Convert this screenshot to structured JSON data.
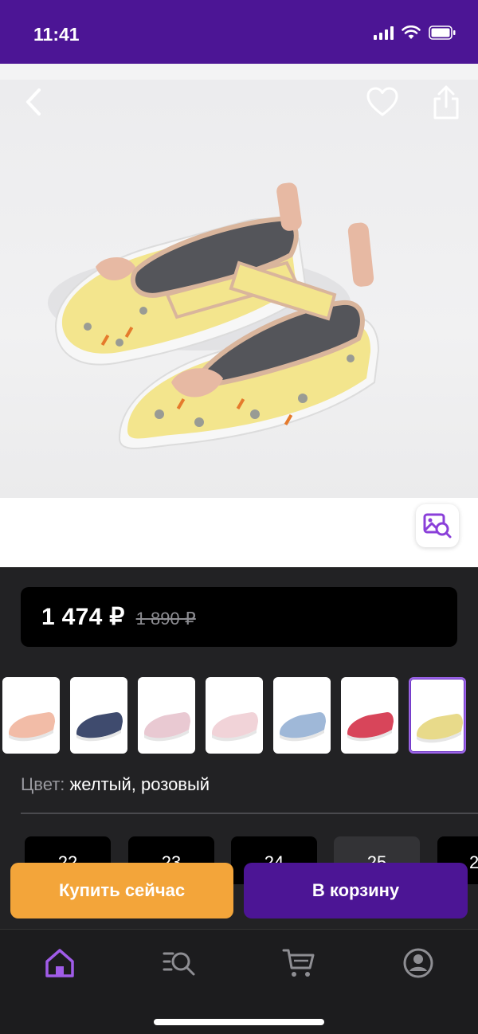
{
  "status_bar": {
    "time": "11:41"
  },
  "product": {
    "price_current": "1 474 ₽",
    "price_old": "1 890 ₽",
    "color_label": "Цвет:",
    "color_value": "желтый, розовый"
  },
  "thumbnails": [
    {
      "name": "thumb-pink",
      "color": "#f2bca7",
      "selected": false
    },
    {
      "name": "thumb-navy",
      "color": "#3f4b6e",
      "selected": false
    },
    {
      "name": "thumb-lightpink",
      "color": "#e9c9d2",
      "selected": false
    },
    {
      "name": "thumb-blush",
      "color": "#f1d3d8",
      "selected": false
    },
    {
      "name": "thumb-blue",
      "color": "#9fb8d8",
      "selected": false
    },
    {
      "name": "thumb-red",
      "color": "#d8455a",
      "selected": false
    },
    {
      "name": "thumb-yellow",
      "color": "#e8da8a",
      "selected": true
    }
  ],
  "sizes": [
    "22",
    "23",
    "24",
    "25",
    "2"
  ],
  "actions": {
    "buy_now": "Купить сейчас",
    "add_to_cart": "В корзину"
  },
  "tabs": [
    {
      "name": "home",
      "icon": "home-icon",
      "active": true
    },
    {
      "name": "search",
      "icon": "search-list-icon",
      "active": false
    },
    {
      "name": "cart",
      "icon": "cart-icon",
      "active": false
    },
    {
      "name": "profile",
      "icon": "profile-icon",
      "active": false
    }
  ],
  "colors": {
    "brand_purple": "#4c1595",
    "accent_orange": "#f3a53a",
    "active_tab": "#a05ce8"
  }
}
